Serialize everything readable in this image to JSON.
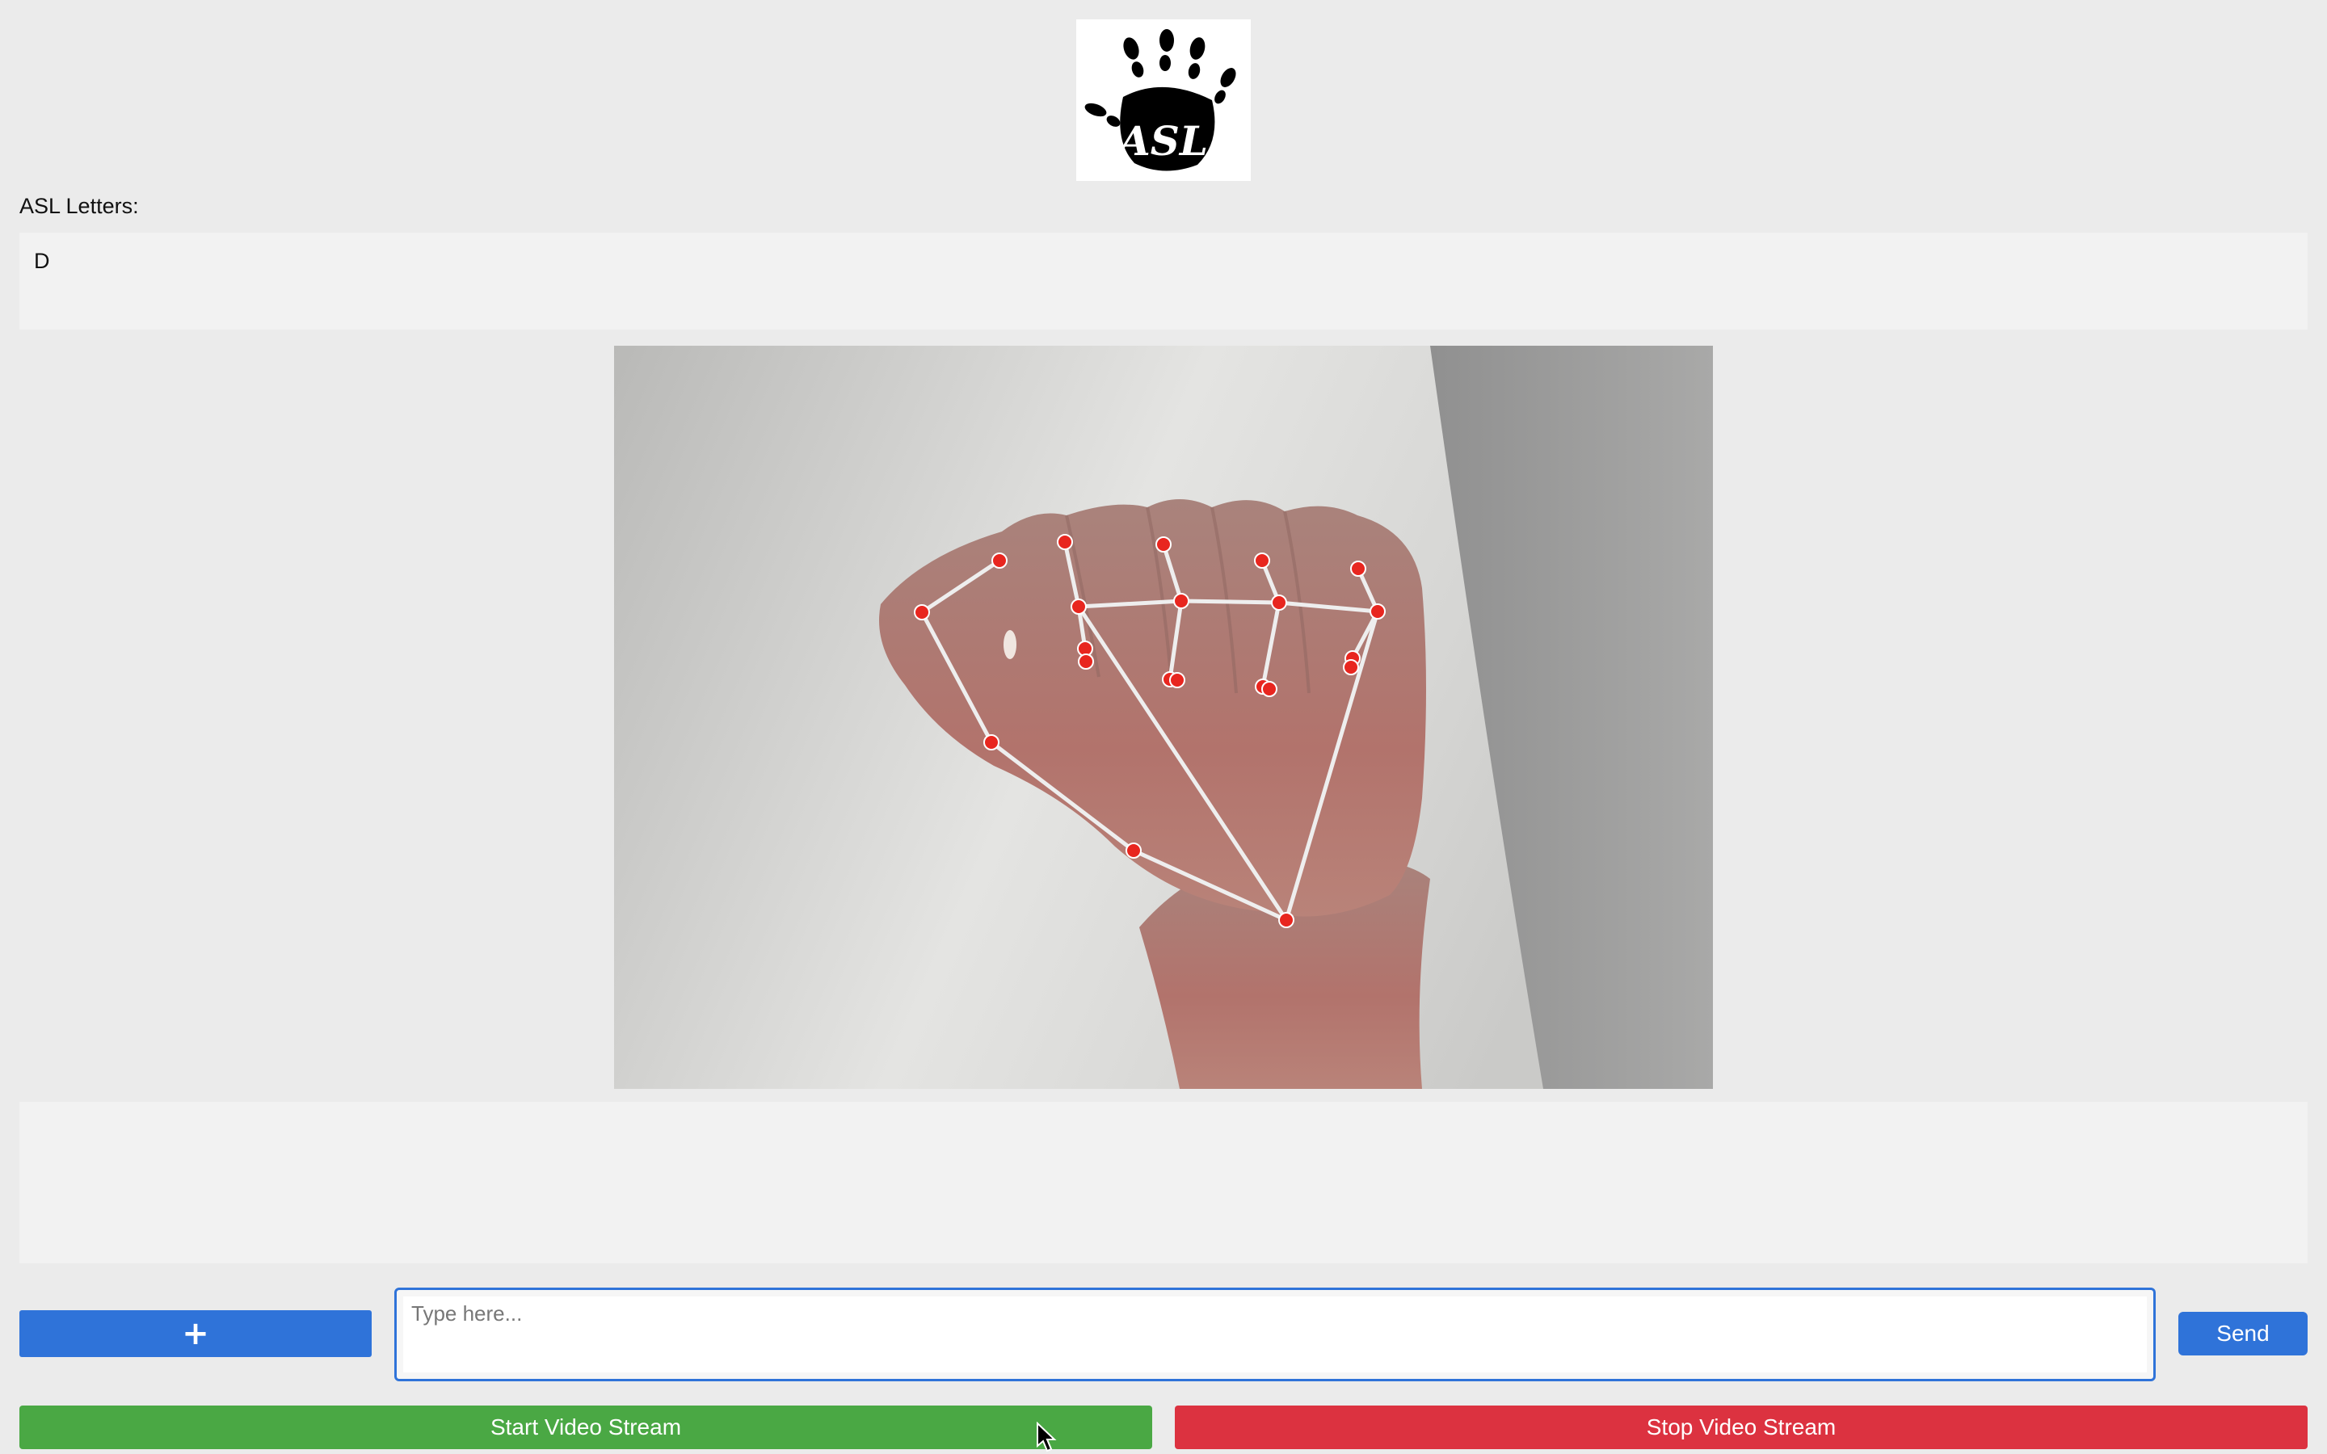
{
  "logo": {
    "text": "ASL",
    "icon": "asl-hand-logo"
  },
  "letters": {
    "label": "ASL Letters:",
    "value": "D"
  },
  "video": {
    "icon": "hand-landmark-video-feed"
  },
  "output": {
    "value": ""
  },
  "controls": {
    "add_label": "+",
    "input_placeholder": "Type here...",
    "input_value": "",
    "send_label": "Send",
    "start_label": "Start Video Stream",
    "stop_label": "Stop Video Stream"
  },
  "colors": {
    "primary_blue": "#2f73d9",
    "start_green": "#4aa844",
    "stop_red": "#dc3240",
    "landmark_red": "#e8261f"
  }
}
